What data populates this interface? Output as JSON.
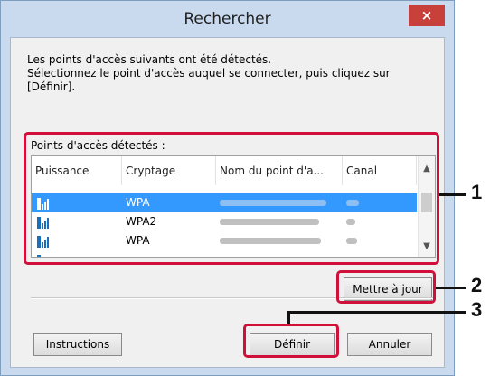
{
  "window": {
    "title": "Rechercher",
    "close_glyph": "×"
  },
  "description": {
    "line1": "Les points d'accès suivants ont été détectés.",
    "line2": "Sélectionnez le point d'accès auquel se connecter, puis cliquez sur",
    "line3": "[Définir]."
  },
  "group_label": "Points d'accès détectés :",
  "table": {
    "columns": [
      "Puissance",
      "Cryptage",
      "Nom du point d'a...",
      "Canal"
    ],
    "rows": [
      {
        "signal_icon": "signal-strength-icon",
        "encryption": "WPA",
        "selected": true
      },
      {
        "signal_icon": "signal-strength-icon",
        "encryption": "WPA2",
        "selected": false
      },
      {
        "signal_icon": "signal-strength-icon",
        "encryption": "WPA",
        "selected": false
      }
    ]
  },
  "buttons": {
    "refresh": "Mettre à jour",
    "instructions": "Instructions",
    "set": "Définir",
    "cancel": "Annuler"
  },
  "callouts": [
    "1",
    "2",
    "3"
  ],
  "colors": {
    "highlight": "#d0103a",
    "selection": "#3399ff",
    "close": "#c7403a",
    "frame": "#c9d9ee"
  }
}
